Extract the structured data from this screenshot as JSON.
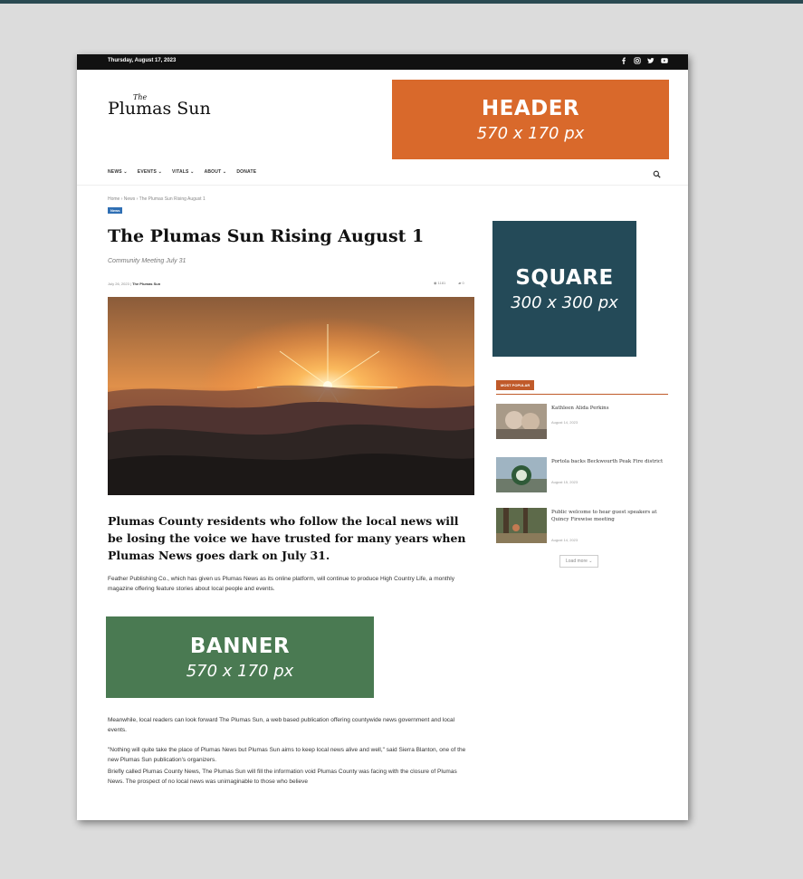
{
  "topbar": {
    "date": "Thursday, August 17, 2023",
    "social_icons": [
      "facebook-icon",
      "instagram-icon",
      "twitter-icon",
      "youtube-icon"
    ]
  },
  "logo": {
    "the": "The",
    "name": "Plumas Sun"
  },
  "nav": {
    "items": [
      "NEWS ⌄",
      "EVENTS ⌄",
      "VITALS ⌄",
      "ABOUT ⌄",
      "DONATE"
    ],
    "search_icon": "search-icon"
  },
  "breadcrumb": "Home › News › The Plumas Sun Rising August 1",
  "article": {
    "category": "News",
    "title": "The Plumas Sun Rising August 1",
    "subtitle": "Community Meeting July 31",
    "date": "July 26, 2023",
    "author": "The Plumas Sun",
    "views": "1181",
    "comments": "0",
    "lede": "Plumas County residents who follow the local news will be losing the voice we have trusted for many years when Plumas News goes dark on July 31.",
    "paragraph1": "Feather Publishing Co., which has given us Plumas News as its online platform, will continue to produce High Country Life, a monthly magazine offering feature stories about local people and events.",
    "paragraph2": "Meanwhile, local readers can look forward The Plumas Sun, a web based publication offering countywide news government and local events.",
    "paragraph3": "\"Nothing will quite take the place of Plumas News but Plumas Sun aims to keep local news alive and well,\" said Sierra Blanton, one of the new Plumas Sun publication's organizers.",
    "paragraph4": "Briefly called Plumas County News, The Plumas Sun will fill the information void Plumas County was facing with the closure of Plumas News. The prospect of no local news was unimaginable to those who believe"
  },
  "sidebar": {
    "popular_label": "MOST POPULAR",
    "items": [
      {
        "title": "Kathleen Alida Perkins",
        "date": "August 14, 2023"
      },
      {
        "title": "Portola backs Beckwourth Peak Fire district",
        "date": "August 15, 2023"
      },
      {
        "title": "Public welcome to hear guest speakers at Quincy Firewise meeting",
        "date": "August 14, 2023"
      }
    ],
    "load_more": "Load more ⌄"
  },
  "ads": {
    "header": {
      "label": "HEADER",
      "size": "570 x 170 px",
      "color": "#d9692b"
    },
    "square": {
      "label": "SQUARE",
      "size": "300 x 300 px",
      "color": "#244a58"
    },
    "banner": {
      "label": "BANNER",
      "size": "570 x 170 px",
      "color": "#4a7a52"
    }
  }
}
